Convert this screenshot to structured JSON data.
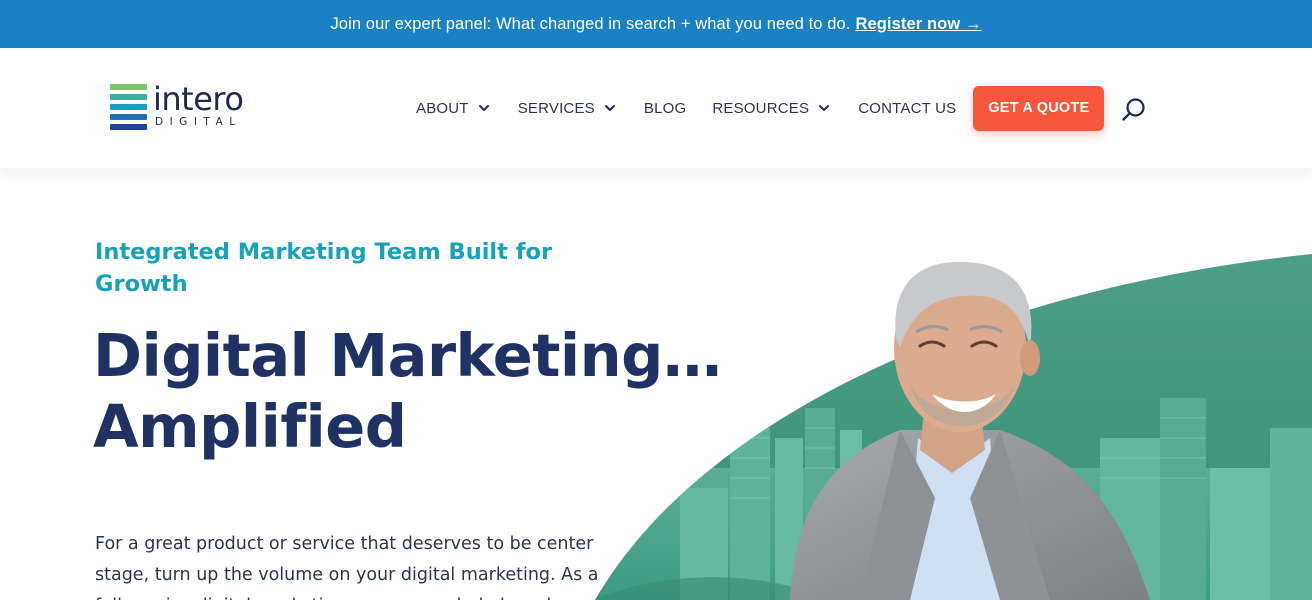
{
  "announcement": {
    "message": "Join our expert panel: What changed in search + what you need to do.",
    "link_label": "Register now →"
  },
  "logo": {
    "word": "intero",
    "sub": "DIGITAL",
    "bar_colors": [
      "#7cc46b",
      "#35b2a0",
      "#1a9cc4",
      "#1f6fb5",
      "#23429a"
    ]
  },
  "nav": {
    "about": "ABOUT",
    "services": "SERVICES",
    "blog": "BLOG",
    "resources": "RESOURCES",
    "contact": "CONTACT US",
    "quote": "GET A QUOTE",
    "search_icon": "search-icon"
  },
  "hero": {
    "eyebrow": "Integrated Marketing Team Built for Growth",
    "title_line1": "Digital Marketing…",
    "title_line2": "Amplified",
    "body": "For a great product or service that deserves to be center stage, turn up the volume on your digital marketing. As a full-service digital marketing agency, we help brands"
  },
  "colors": {
    "announcement_bg": "#1a82c4",
    "accent_orange": "#f6573c",
    "eyebrow_teal": "#17a2b8",
    "title_navy": "#1f3263",
    "hero_green": "#3f9a80"
  }
}
